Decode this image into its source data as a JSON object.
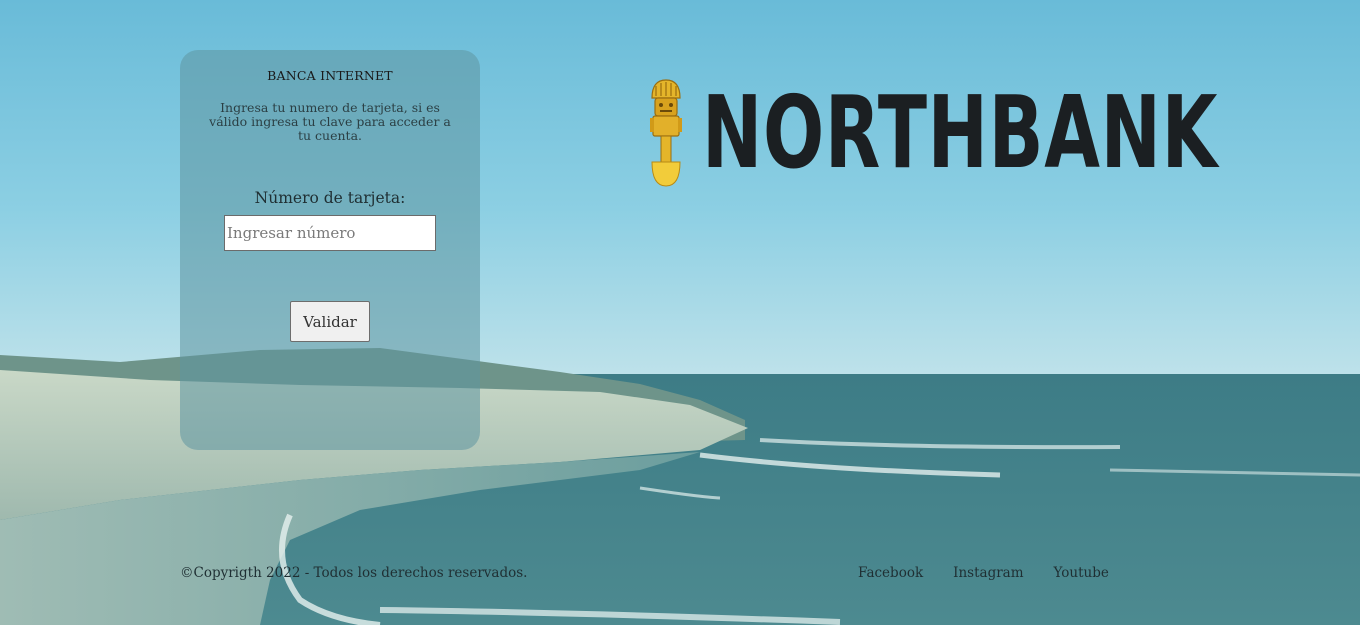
{
  "login": {
    "title": "BANCA INTERNET",
    "description": "Ingresa tu numero de tarjeta, si es válido ingresa tu clave para acceder a tu cuenta.",
    "card_label": "Número de tarjeta:",
    "card_placeholder": "Ingresar número",
    "card_value": "",
    "validate_label": "Validar"
  },
  "brand": {
    "name": "NORTHBANK",
    "logo_icon": "tumi-icon"
  },
  "footer": {
    "copyright": "©Copyrigth 2022 - Todos los derechos reservados.",
    "links": [
      "Facebook",
      "Instagram",
      "Youtube"
    ]
  },
  "colors": {
    "sky": "#6cbfdb",
    "sea": "#3e7f86",
    "card": "#5f96a0",
    "brand_text": "#1b1f22",
    "logo_gold": "#e4b52a"
  }
}
